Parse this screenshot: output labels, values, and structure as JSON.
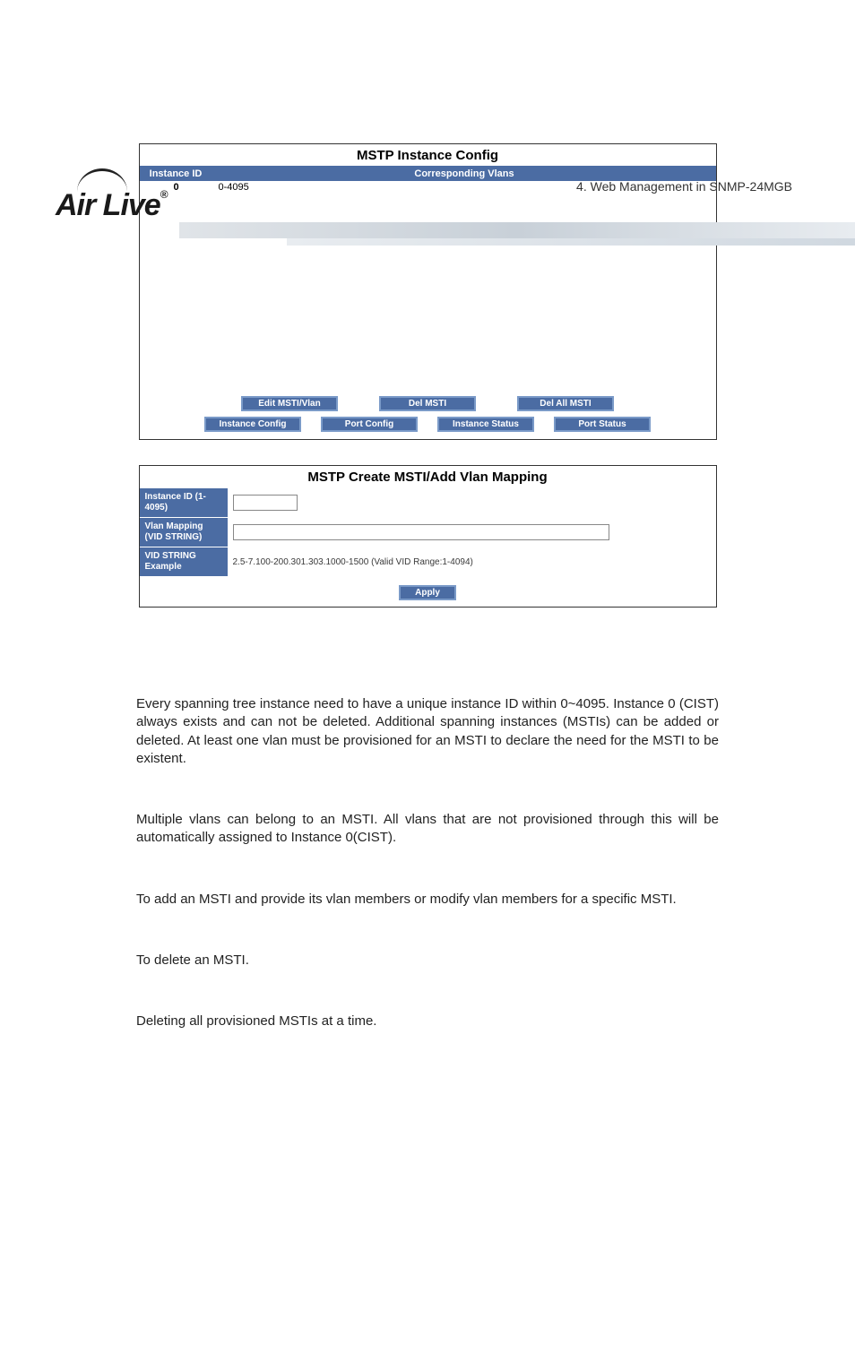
{
  "header": {
    "logo_text": "Air Live",
    "chapter": "4.  Web  Management  in  SNMP-24MGB"
  },
  "panel1": {
    "title": "MSTP Instance Config",
    "th_instance": "Instance ID",
    "th_vlans": "Corresponding Vlans",
    "row0_id": "0",
    "row0_vlans": "0-4095",
    "btn_edit": "Edit MSTI/Vlan",
    "btn_del": "Del MSTI",
    "btn_delall": "Del All MSTI",
    "btn_instcfg": "Instance Config",
    "btn_portcfg": "Port Config",
    "btn_inststat": "Instance Status",
    "btn_portstat": "Port Status"
  },
  "panel2": {
    "title": "MSTP Create MSTI/Add Vlan Mapping",
    "lbl_instance": "Instance ID (1-4095)",
    "lbl_vlanmap": "Vlan Mapping (VID STRING)",
    "lbl_example": "VID STRING Example",
    "example_text": "2.5-7.100-200.301.303.1000-1500 (Valid VID Range:1-4094)",
    "btn_apply": "Apply"
  },
  "paragraphs": {
    "p1": "Every spanning tree instance need to have a unique instance ID within 0~4095. Instance 0 (CIST) always exists and can not be deleted. Additional spanning instances (MSTIs) can be added or deleted. At least one vlan must be provisioned for an MSTI to declare the need for the MSTI to be existent.",
    "p2": "Multiple vlans can belong to an MSTI. All vlans that are not provisioned through this will be automatically assigned to Instance 0(CIST).",
    "p3": "To add an MSTI and provide its vlan members or modify vlan members for a specific MSTI.",
    "p4": "To delete an MSTI.",
    "p5": "Deleting all provisioned MSTIs at a time."
  }
}
